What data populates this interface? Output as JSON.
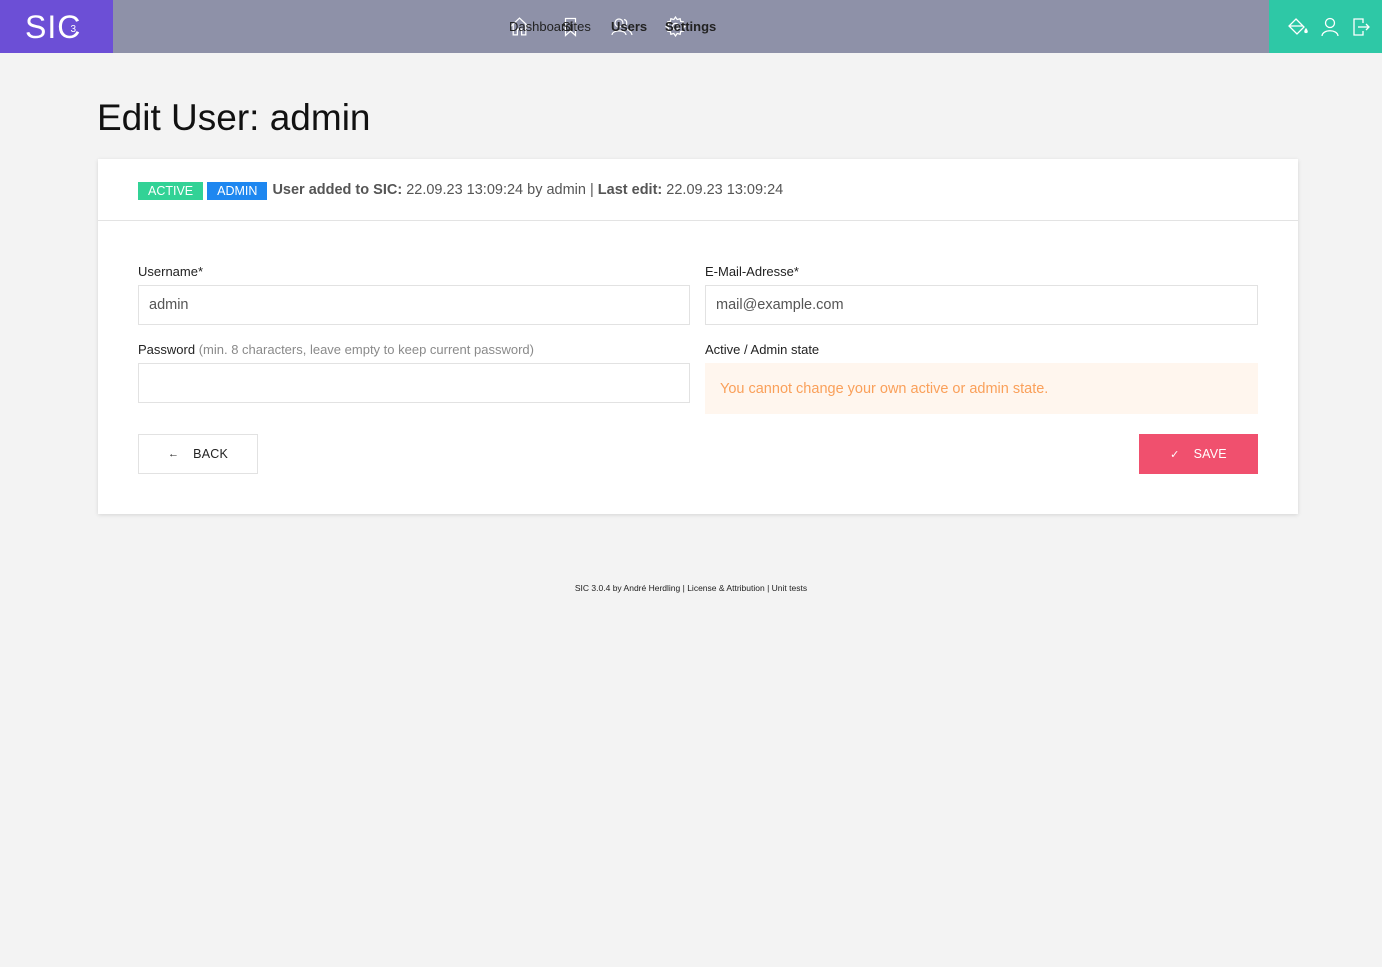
{
  "app": {
    "logo_text": "SIC",
    "logo_superscript": "3",
    "colors": {
      "logo_bg": "#6c4fd6",
      "topbar_bg": "#8e91a8",
      "tools_bg": "#2ec8a6",
      "save_btn": "#f0506e",
      "active_badge": "#32d296",
      "admin_badge": "#1e87f0",
      "warning_text": "#faa05a",
      "warning_bg": "#fff6ee"
    }
  },
  "nav": {
    "items": [
      {
        "label": "Dashboard",
        "icon": "home-icon",
        "active": false
      },
      {
        "label": "Sites",
        "icon": "bookmark-icon",
        "active": false
      },
      {
        "label": "Users",
        "icon": "users-icon",
        "active": true
      },
      {
        "label": "Settings",
        "icon": "gear-icon",
        "active": true
      }
    ],
    "tools": [
      {
        "icon": "paint-bucket-icon"
      },
      {
        "icon": "user-icon"
      },
      {
        "icon": "sign-out-icon"
      }
    ]
  },
  "page": {
    "title": "Edit User: admin"
  },
  "card": {
    "badges": {
      "active": "ACTIVE",
      "admin": "ADMIN"
    },
    "meta": {
      "added_label": "User added to SIC:",
      "added_value": "22.09.23 13:09:24 by admin |",
      "edit_label": "Last edit:",
      "edit_value": "22.09.23 13:09:24"
    },
    "form": {
      "username_label": "Username*",
      "username_value": "admin",
      "email_label": "E-Mail-Adresse*",
      "email_value": "mail@example.com",
      "password_label": "Password",
      "password_hint": "(min. 8 characters, leave empty to keep current password)",
      "password_value": "",
      "state_label": "Active / Admin state",
      "state_warning": "You cannot change your own active or admin state."
    },
    "buttons": {
      "back_icon": "←",
      "back_label": "BACK",
      "save_icon": "✓",
      "save_label": "SAVE"
    }
  },
  "footer": {
    "prefix": "SIC 3.0.4 by André Herdling |",
    "license": "License & Attribution",
    "sep": "|",
    "tests": "Unit tests"
  }
}
